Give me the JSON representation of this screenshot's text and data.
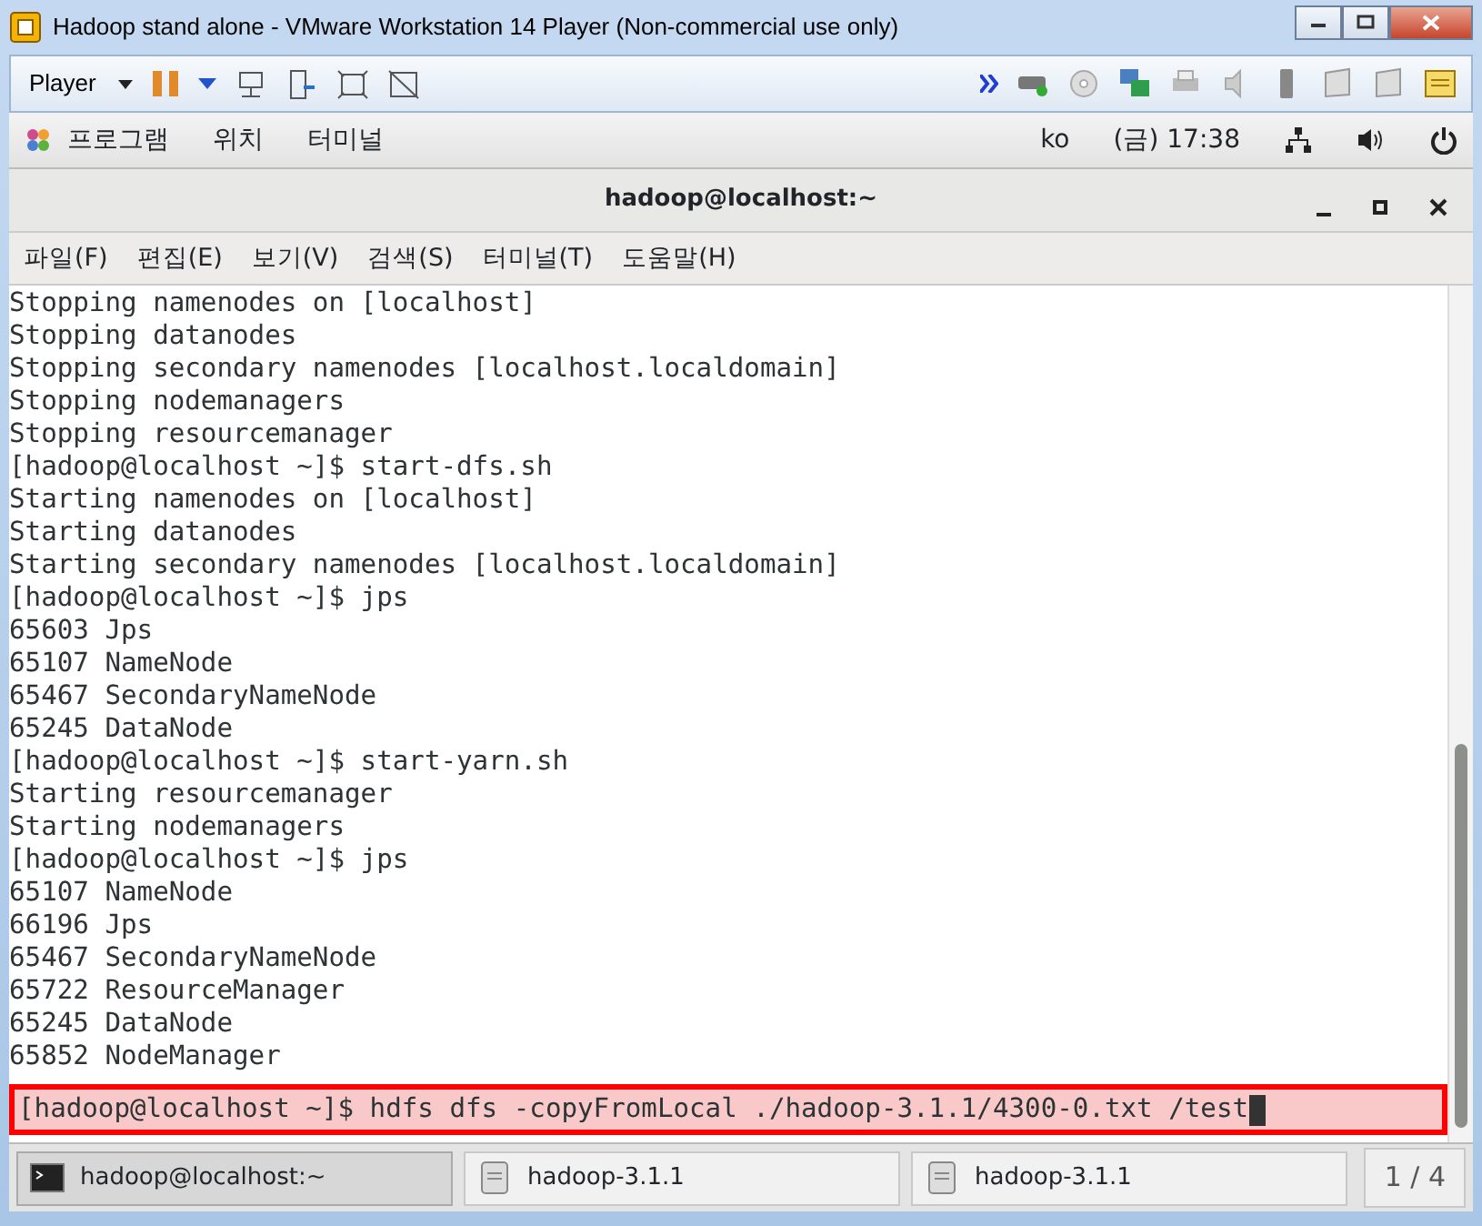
{
  "window": {
    "title": "Hadoop stand alone - VMware Workstation 14 Player (Non-commercial use only)"
  },
  "player_toolbar": {
    "menu": "Player"
  },
  "top_bar": {
    "menus": [
      "프로그램",
      "위치",
      "터미널"
    ],
    "language": "ko",
    "clock": "(금) 17:38"
  },
  "terminal": {
    "title": "hadoop@localhost:~",
    "menus": [
      "파일(F)",
      "편집(E)",
      "보기(V)",
      "검색(S)",
      "터미널(T)",
      "도움말(H)"
    ],
    "lines": [
      "Stopping namenodes on [localhost]",
      "Stopping datanodes",
      "Stopping secondary namenodes [localhost.localdomain]",
      "Stopping nodemanagers",
      "Stopping resourcemanager",
      "[hadoop@localhost ~]$ start-dfs.sh",
      "Starting namenodes on [localhost]",
      "Starting datanodes",
      "Starting secondary namenodes [localhost.localdomain]",
      "[hadoop@localhost ~]$ jps",
      "65603 Jps",
      "65107 NameNode",
      "65467 SecondaryNameNode",
      "65245 DataNode",
      "[hadoop@localhost ~]$ start-yarn.sh",
      "Starting resourcemanager",
      "Starting nodemanagers",
      "[hadoop@localhost ~]$ jps",
      "65107 NameNode",
      "66196 Jps",
      "65467 SecondaryNameNode",
      "65722 ResourceManager",
      "65245 DataNode",
      "65852 NodeManager"
    ],
    "prompt_line": {
      "text": "[hadoop@localhost ~]$ hdfs dfs -copyFromLocal ./hadoop-3.1.1/4300-0.txt /test",
      "highlighted": true
    }
  },
  "taskbar": {
    "items": [
      {
        "kind": "terminal",
        "label": "hadoop@localhost:~",
        "selected": true
      },
      {
        "kind": "folder",
        "label": "hadoop-3.1.1",
        "selected": false
      },
      {
        "kind": "folder",
        "label": "hadoop-3.1.1",
        "selected": false
      }
    ],
    "workspace": "1 / 4"
  }
}
